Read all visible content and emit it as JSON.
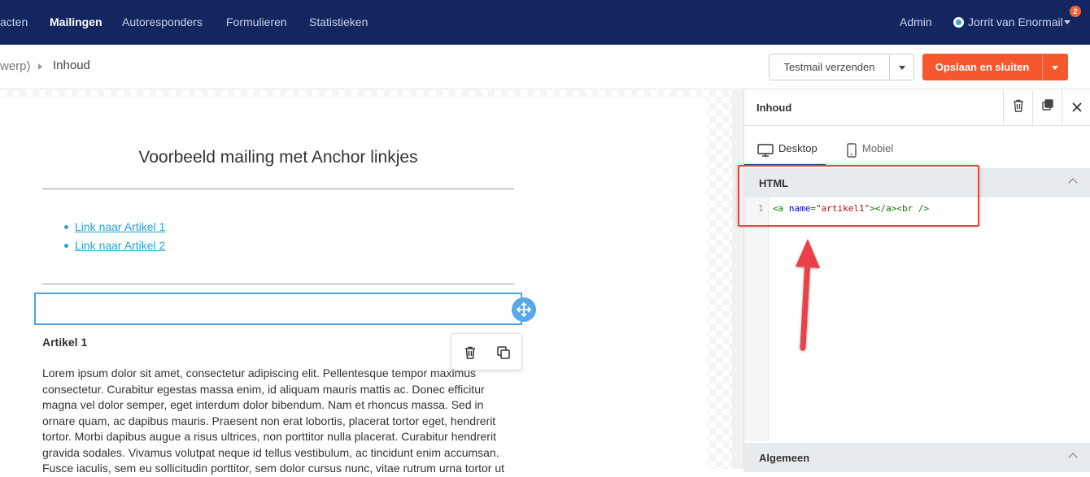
{
  "topnav": {
    "items": [
      "acten",
      "Mailingen",
      "Autoresponders",
      "Formulieren",
      "Statistieken"
    ],
    "active_index": 1,
    "admin_label": "Admin",
    "user_name": "Jorrit van Enormail",
    "notification_count": "2"
  },
  "breadcrumb": {
    "previous": "werp)",
    "current": "Inhoud"
  },
  "actions": {
    "test_label": "Testmail verzenden",
    "save_label": "Opslaan en sluiten"
  },
  "mail": {
    "title": "Voorbeeld mailing met Anchor linkjes",
    "links": [
      "Link naar Artikel 1",
      "Link naar Artikel 2"
    ],
    "article_heading": "Artikel 1",
    "article_body": "Lorem ipsum dolor sit amet, consectetur adipiscing elit. Pellentesque tempor maximus consectetur. Curabitur egestas massa enim, id aliquam mauris mattis ac. Donec efficitur magna vel dolor semper, eget interdum dolor bibendum. Nam et rhoncus massa. Sed in ornare quam, ac dapibus mauris. Praesent non erat lobortis, placerat tortor eget, hendrerit tortor. Morbi dapibus augue a risus ultrices, non porttitor nulla placerat. Curabitur hendrerit gravida sodales. Vivamus volutpat neque id tellus vestibulum, ac tincidunt enim accumsan. Fusce iaculis, sem eu sollicitudin porttitor, sem dolor cursus nunc, vitae rutrum urna tortor ut"
  },
  "panel": {
    "title": "Inhoud",
    "tabs": [
      "Desktop",
      "Mobiel"
    ],
    "active_tab": 0,
    "html_section_label": "HTML",
    "general_section_label": "Algemeen",
    "code": {
      "line_number": "1",
      "tag_open": "<a",
      "attr_name": "name",
      "equals": "=",
      "attr_value": "\"artikel1\"",
      "rest": "></a><br />"
    }
  },
  "colors": {
    "nav_bg": "#13265f",
    "accent_orange": "#f7572c",
    "link_blue": "#2aa0d8",
    "selection_blue": "#4da3e8",
    "annotation_red": "#e04a45"
  },
  "icons": [
    "power-icon",
    "caret-down-icon",
    "move-icon",
    "trash-icon",
    "duplicate-icon",
    "close-icon",
    "desktop-icon",
    "mobile-icon",
    "chevron-up-icon",
    "arrow-annotation"
  ]
}
